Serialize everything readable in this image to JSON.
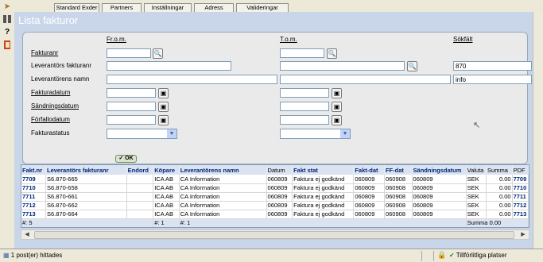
{
  "tabs": [
    "Standard Exder",
    "Partners",
    "Inställningar",
    "Adress",
    "Valideringar"
  ],
  "left_icons": [
    "export-icon",
    "columns-icon",
    "help-icon",
    "book-icon"
  ],
  "page_title": "Lista fakturor",
  "form": {
    "col_from": "Fr.o.m.",
    "col_to": "T.o.m.",
    "col_search": "Sökfält",
    "fields": {
      "fakturanr": "Fakturanr",
      "lev_fakturanr": "Leverantörs fakturanr",
      "lev_namn": "Leverantörens namn",
      "fakturadatum": "Fakturadatum",
      "sandningsdatum": "Sändningsdatum",
      "forfallodatum": "Förfallodatum",
      "fakturastatus": "Fakturastatus"
    },
    "values": {
      "fakturanr_from": "",
      "fakturanr_to": "",
      "lev_fakturanr_from": "",
      "lev_fakturanr_search": "870",
      "lev_namn_from": "",
      "lev_namn_to": "",
      "lev_namn_search": "info",
      "fakturadatum_from": "",
      "fakturadatum_to": "",
      "sandningsdatum_from": "",
      "sandningsdatum_to": "",
      "forfallodatum_from": "",
      "forfallodatum_to": "",
      "status_from": "",
      "status_to": ""
    },
    "ok_label": "OK"
  },
  "table": {
    "headers": [
      "Fakt.nr",
      "Leverantörs fakturanr",
      "Endord",
      "Köpare",
      "Leverantörens namn",
      "Datum",
      "Fakt stat",
      "Fakt-dat",
      "FF-dat",
      "Sändningsdatum",
      "Valuta",
      "Summa",
      "PDF"
    ],
    "rows": [
      [
        "7709",
        "S6.870-665",
        "",
        "ICA AB",
        "CA Information",
        "060809",
        "Faktura ej godkänd",
        "060809",
        "060908",
        "060809",
        "SEK",
        "0.00",
        "7709"
      ],
      [
        "7710",
        "S6.870-658",
        "",
        "ICA AB",
        "CA Information",
        "060809",
        "Faktura ej godkänd",
        "060809",
        "060908",
        "060809",
        "SEK",
        "0.00",
        "7710"
      ],
      [
        "7711",
        "S6.870-661",
        "",
        "ICA AB",
        "CA Information",
        "060809",
        "Faktura ej godkänd",
        "060809",
        "060908",
        "060809",
        "SEK",
        "0.00",
        "7711"
      ],
      [
        "7712",
        "S6.870-662",
        "",
        "ICA AB",
        "CA Information",
        "060809",
        "Faktura ej godkänd",
        "060809",
        "060908",
        "060809",
        "SEK",
        "0.00",
        "7712"
      ],
      [
        "7713",
        "S6.870-664",
        "",
        "ICA AB",
        "CA Information",
        "060809",
        "Faktura ej godkänd",
        "060809",
        "060908",
        "060809",
        "SEK",
        "0.00",
        "7713"
      ]
    ],
    "footer": {
      "count_nr": "#: 5",
      "count_kopare": "#: 1",
      "count_namn": "#: 1",
      "summa": "Summa 0.00"
    }
  },
  "status": {
    "left": "1 post(er) hittades",
    "right": "Tillförlitliga platser"
  },
  "colors": {
    "panel_bg": "#c9d6e9",
    "header_text": "#00277a",
    "chrome_bg": "#ece9d8"
  }
}
